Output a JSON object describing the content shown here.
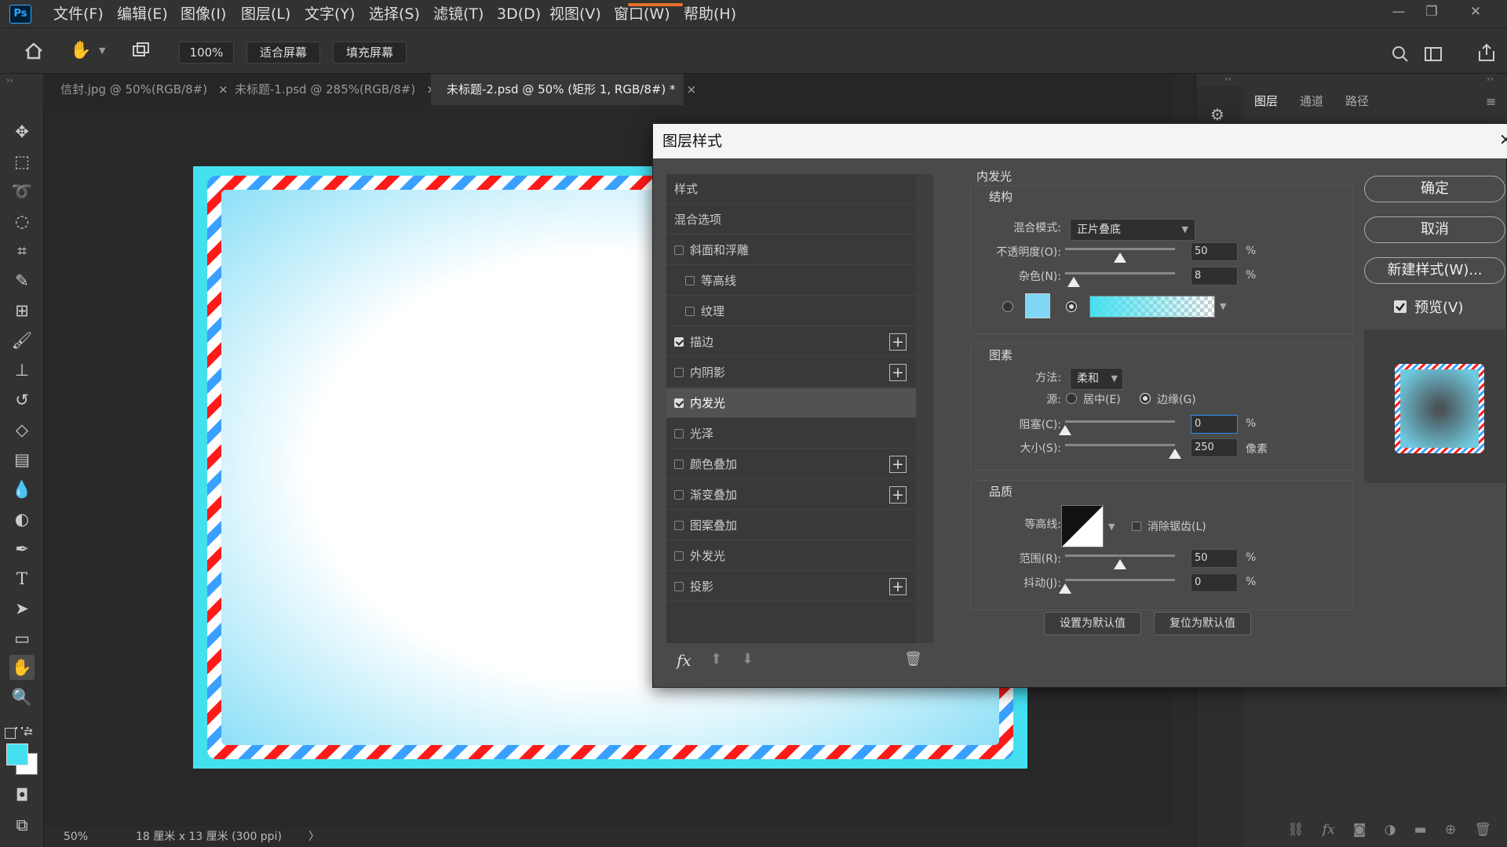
{
  "app": {
    "logo": "Ps"
  },
  "menu": [
    "文件(F)",
    "编辑(E)",
    "图像(I)",
    "图层(L)",
    "文字(Y)",
    "选择(S)",
    "滤镜(T)",
    "3D(D)",
    "视图(V)",
    "窗口(W)",
    "帮助(H)"
  ],
  "options": {
    "zoom": "100%",
    "fit_screen": "适合屏幕",
    "fill_screen": "填充屏幕"
  },
  "tabs": [
    {
      "label": "信封.jpg @ 50%(RGB/8#)"
    },
    {
      "label": "未标题-1.psd @ 285%(RGB/8#)"
    },
    {
      "label": "未标题-2.psd @ 50% (矩形 1, RGB/8#) *"
    }
  ],
  "tab_close": "×",
  "status": {
    "zoom": "50%",
    "doc_info": "18 厘米 x 13 厘米 (300 ppi)",
    "arrow": "〉"
  },
  "right_panel": {
    "tabs": [
      "图层",
      "通道",
      "路径"
    ]
  },
  "dialog": {
    "title": "图层样式",
    "close": "✕",
    "styles": [
      {
        "label": "样式",
        "checkbox": false,
        "checked": false,
        "indent": false,
        "plus": false,
        "selected": false
      },
      {
        "label": "混合选项",
        "checkbox": false,
        "checked": false,
        "indent": false,
        "plus": false,
        "selected": false
      },
      {
        "label": "斜面和浮雕",
        "checkbox": true,
        "checked": false,
        "indent": false,
        "plus": false,
        "selected": false
      },
      {
        "label": "等高线",
        "checkbox": true,
        "checked": false,
        "indent": true,
        "plus": false,
        "selected": false
      },
      {
        "label": "纹理",
        "checkbox": true,
        "checked": false,
        "indent": true,
        "plus": false,
        "selected": false
      },
      {
        "label": "描边",
        "checkbox": true,
        "checked": true,
        "indent": false,
        "plus": true,
        "selected": false
      },
      {
        "label": "内阴影",
        "checkbox": true,
        "checked": false,
        "indent": false,
        "plus": true,
        "selected": false
      },
      {
        "label": "内发光",
        "checkbox": true,
        "checked": true,
        "indent": false,
        "plus": false,
        "selected": true
      },
      {
        "label": "光泽",
        "checkbox": true,
        "checked": false,
        "indent": false,
        "plus": false,
        "selected": false
      },
      {
        "label": "颜色叠加",
        "checkbox": true,
        "checked": false,
        "indent": false,
        "plus": true,
        "selected": false
      },
      {
        "label": "渐变叠加",
        "checkbox": true,
        "checked": false,
        "indent": false,
        "plus": true,
        "selected": false
      },
      {
        "label": "图案叠加",
        "checkbox": true,
        "checked": false,
        "indent": false,
        "plus": false,
        "selected": false
      },
      {
        "label": "外发光",
        "checkbox": true,
        "checked": false,
        "indent": false,
        "plus": false,
        "selected": false
      },
      {
        "label": "投影",
        "checkbox": true,
        "checked": false,
        "indent": false,
        "plus": true,
        "selected": false
      }
    ],
    "fx_label": "fx",
    "section_title": "内发光",
    "structure": {
      "title": "结构",
      "blend_mode_label": "混合模式:",
      "blend_mode": "正片叠底",
      "opacity_label": "不透明度(O):",
      "opacity": "50",
      "opacity_pct": 50,
      "noise_label": "杂色(N):",
      "noise": "8",
      "noise_pct": 8,
      "unit_pct": "%",
      "swatch_color": "#7fd6f5",
      "gradient_color": "#44e0f0"
    },
    "elements": {
      "title": "图素",
      "technique_label": "方法:",
      "technique": "柔和",
      "source_label": "源:",
      "center": "居中(E)",
      "edge": "边缘(G)",
      "choke_label": "阻塞(C):",
      "choke": "0",
      "choke_pct": 0,
      "size_label": "大小(S):",
      "size": "250",
      "size_pct": 100,
      "unit_px": "像素"
    },
    "quality": {
      "title": "品质",
      "contour_label": "等高线:",
      "anti_alias": "消除锯齿(L)",
      "range_label": "范围(R):",
      "range": "50",
      "range_pct": 50,
      "jitter_label": "抖动(J):",
      "jitter": "0",
      "jitter_pct": 0
    },
    "make_default": "设置为默认值",
    "reset_default": "复位为默认值",
    "buttons": {
      "ok": "确定",
      "cancel": "取消",
      "new_style": "新建样式(W)...",
      "preview": "预览(V)"
    }
  },
  "colors": {
    "accent": "#44e0f0",
    "stripe_red": "#ff1a1a",
    "stripe_blue": "#3aa0ff",
    "foreground": "#44e0f0"
  }
}
